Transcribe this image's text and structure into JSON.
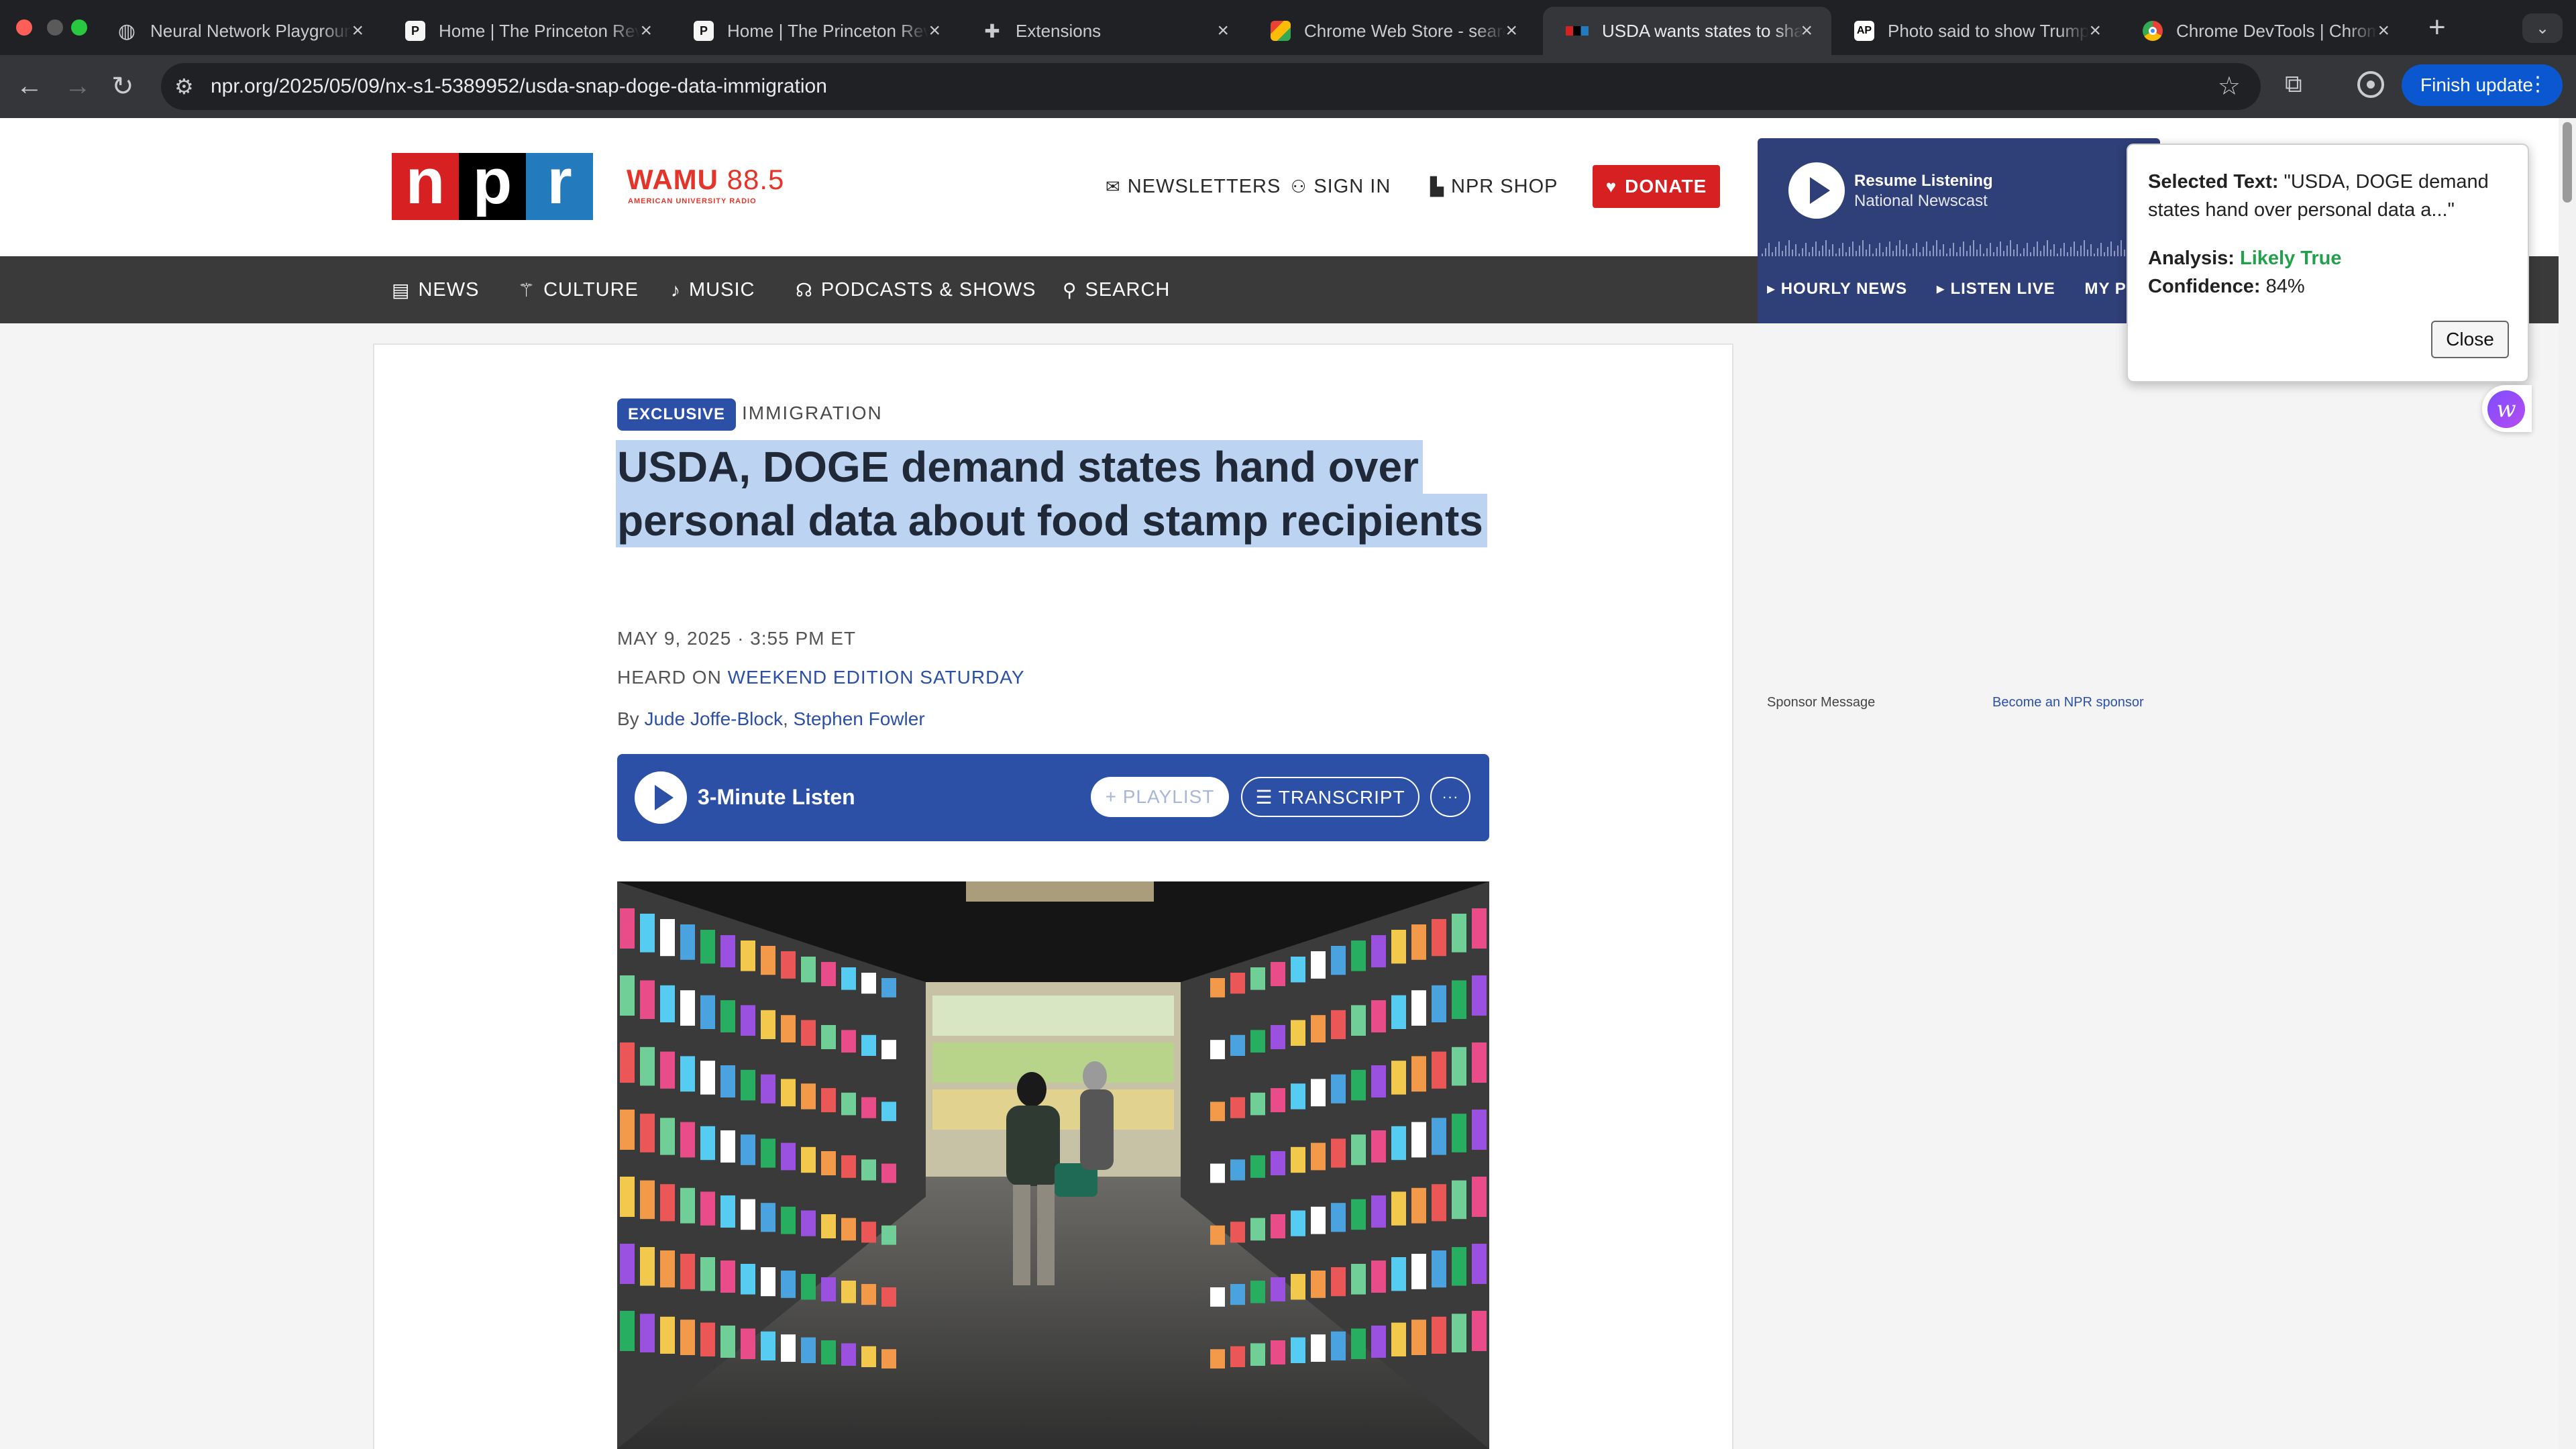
{
  "browser": {
    "tabs": [
      {
        "title": "Neural Network Playground",
        "favicon": "globe-icon"
      },
      {
        "title": "Home | The Princeton Review",
        "favicon": "P"
      },
      {
        "title": "Home | The Princeton Review",
        "favicon": "P"
      },
      {
        "title": "Extensions",
        "favicon": "puzzle-icon"
      },
      {
        "title": "Chrome Web Store - search",
        "favicon": "web-store-icon"
      },
      {
        "title": "USDA wants states to share",
        "favicon": "npr"
      },
      {
        "title": "Photo said to show Trump",
        "favicon": "AP"
      },
      {
        "title": "Chrome DevTools | Chrome",
        "favicon": "chrome-icon"
      }
    ],
    "close_glyph": "×",
    "newtab_glyph": "+",
    "url": "npr.org/2025/05/09/nx-s1-5389952/usda-snap-doge-data-immigration",
    "update_label": "Finish update"
  },
  "header": {
    "logo_letters": [
      "n",
      "p",
      "r"
    ],
    "station": "WAMU",
    "frequency": "88.5",
    "station_sub": "AMERICAN UNIVERSITY RADIO",
    "links": {
      "newsletters": "NEWSLETTERS",
      "signin": "SIGN IN",
      "shop": "NPR SHOP"
    },
    "donate": "DONATE"
  },
  "nav": {
    "news": "NEWS",
    "culture": "CULTURE",
    "music": "MUSIC",
    "podcasts": "PODCASTS & SHOWS",
    "search": "SEARCH"
  },
  "player": {
    "title": "Resume Listening",
    "subtitle": "National Newscast",
    "links": [
      "▸ HOURLY NEWS",
      "▸ LISTEN LIVE",
      "MY PLAYLIST"
    ]
  },
  "popup": {
    "selected_label": "Selected Text:",
    "selected_text": "\"USDA, DOGE demand states hand over personal data a...\"",
    "analysis_label": "Analysis:",
    "analysis_value": "Likely True",
    "confidence_label": "Confidence:",
    "confidence_value": "84%",
    "close_label": "Close"
  },
  "article": {
    "badge": "EXCLUSIVE",
    "slug": "IMMIGRATION",
    "headline": "USDA, DOGE demand states hand over personal data about food stamp recipients",
    "date": "MAY 9, 2025 · 3:55 PM ET",
    "heard_on_label": "HEARD ON",
    "heard_on_show": "WEEKEND EDITION SATURDAY",
    "byline_prefix": "By",
    "author1": "Jude Joffe-Block",
    "author_sep": ",",
    "author2": "Stephen Fowler",
    "listen_label": "3-Minute Listen",
    "playlist_label": "+ PLAYLIST",
    "transcript_label": "☰ TRANSCRIPT",
    "more_glyph": "···"
  },
  "sidebar": {
    "sponsor": "Sponsor Message",
    "become_sponsor": "Become an NPR sponsor"
  },
  "colors": {
    "npr_n": "#d62021",
    "npr_p": "#000000",
    "npr_r": "#237bbd",
    "brand_blue": "#2b50a6",
    "highlight": "#bcd3f1"
  }
}
